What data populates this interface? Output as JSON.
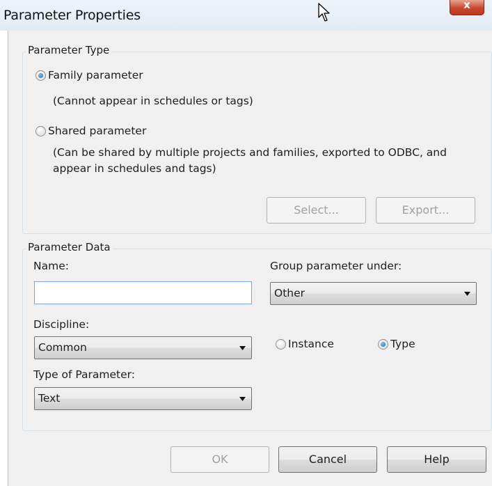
{
  "window": {
    "title": "Parameter Properties",
    "close_label": "x"
  },
  "parameter_type": {
    "group_title": "Parameter Type",
    "family_label": "Family parameter",
    "family_note": "(Cannot appear in schedules or tags)",
    "shared_label": "Shared parameter",
    "shared_note_line1": "(Can be shared by multiple projects and families, exported to ODBC, and",
    "shared_note_line2": "appear in schedules and tags)",
    "selected": "Family parameter",
    "select_button": "Select...",
    "export_button": "Export..."
  },
  "parameter_data": {
    "group_title": "Parameter Data",
    "name_label": "Name:",
    "name_value": "",
    "group_under_label": "Group parameter under:",
    "group_under_value": "Other",
    "discipline_label": "Discipline:",
    "discipline_value": "Common",
    "instance_label": "Instance",
    "type_label": "Type",
    "selected_scope": "Type",
    "type_of_parameter_label": "Type of Parameter:",
    "type_of_parameter_value": "Text"
  },
  "footer": {
    "ok": "OK",
    "cancel": "Cancel",
    "help": "Help"
  },
  "colors": {
    "dialog_bg": "#f0f0f0",
    "radio_selected": "#1d5fb8",
    "close_button": "#c9472c"
  }
}
